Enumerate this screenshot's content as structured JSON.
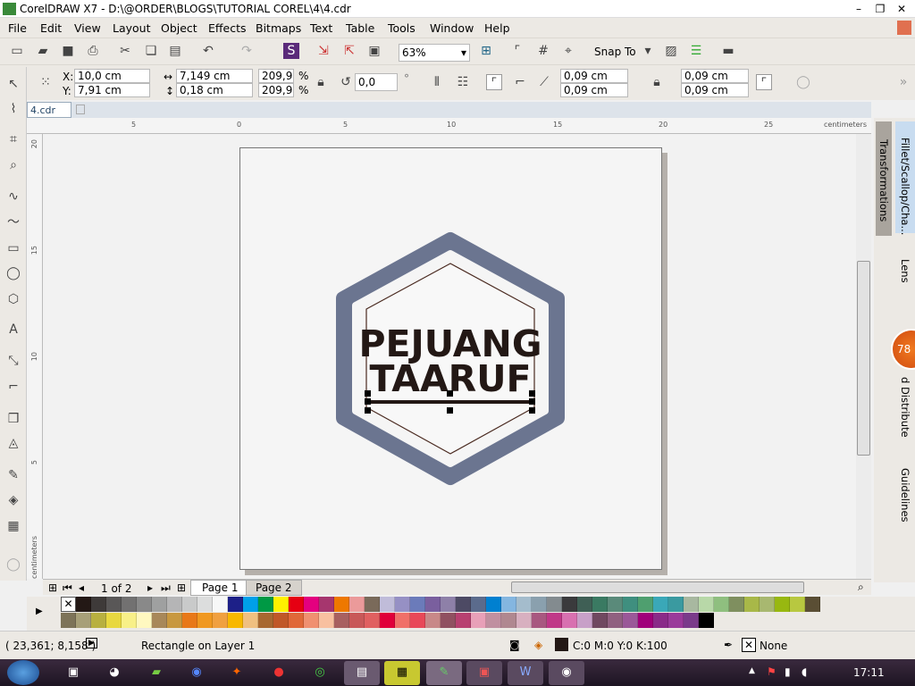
{
  "window": {
    "title": "CorelDRAW X7 - D:\\@ORDER\\BLOGS\\TUTORIAL COREL\\4\\4.cdr"
  },
  "menu": [
    "File",
    "Edit",
    "View",
    "Layout",
    "Object",
    "Effects",
    "Bitmaps",
    "Text",
    "Table",
    "Tools",
    "Window",
    "Help"
  ],
  "toolbar": {
    "zoom": "63%",
    "snap_to": "Snap To"
  },
  "propbar": {
    "x": "10,0 cm",
    "y": "7,91 cm",
    "x_label": "X:",
    "y_label": "Y:",
    "width": "7,149 cm",
    "height": "0,18 cm",
    "scale_x": "209,9",
    "scale_y": "209,9",
    "pct": "%",
    "rotation": "0,0",
    "degree": "°",
    "corner_tl": "0,09 cm",
    "corner_bl": "0,09 cm",
    "corner_tr": "0,09 cm",
    "corner_br": "0,09 cm"
  },
  "document": {
    "tab": "4.cdr",
    "ruler_unit": "centimeters",
    "ruler_left_unit": "centimeters",
    "top_ticks": [
      "5",
      "0",
      "5",
      "10",
      "15",
      "20",
      "25"
    ],
    "left_ticks": [
      "20",
      "15",
      "10",
      "5"
    ]
  },
  "artwork": {
    "line1": "PEJUANG",
    "line2": "TAARUF",
    "hex_color": "#6b7590",
    "text_color": "#231815"
  },
  "dockers": [
    "Transformations",
    "Fillet/Scallop/Cha...",
    "Lens",
    "d Distribute",
    "Guidelines"
  ],
  "badge": "78",
  "pagenav": {
    "counter": "1 of 2",
    "pages": [
      "Page 1",
      "Page 2"
    ]
  },
  "palette": {
    "row1": [
      "#231815",
      "#3e3a39",
      "#595757",
      "#727171",
      "#898989",
      "#9fa0a0",
      "#b5b5b6",
      "#c9caca",
      "#dcdddd",
      "#f7f8f8",
      "#1d2088",
      "#00a0e9",
      "#009944",
      "#fff100",
      "#e60012",
      "#e4007f",
      "#a6366e",
      "#ee7800",
      "#eb9a9a",
      "#7a6a5a",
      "#c0bcd9",
      "#9690c4",
      "#6b7bba",
      "#7a5f9e",
      "#8e80a8",
      "#4d4a64",
      "#5b6b8c",
      "#0080d0",
      "#84b6e0",
      "#a4bccc",
      "#8aa0ae",
      "#838b8f",
      "#3a3a3c",
      "#3f5f55",
      "#3a7a62",
      "#5a8a7a",
      "#3f8f7f",
      "#4f9f6f",
      "#3aa8b8",
      "#3a9aa0",
      "#a8b8a0",
      "#b8d8a8",
      "#8fbf7f",
      "#7f8f5f",
      "#a8b848",
      "#a8b870",
      "#98b810",
      "#b8c840",
      "#5a4e34"
    ],
    "row2": [
      "#7d7358",
      "#a79f78",
      "#b8b040",
      "#e8d840",
      "#f8f088",
      "#fff8c0",
      "#a8885a",
      "#c89840",
      "#e87818",
      "#f09820",
      "#f0a040",
      "#f8b800",
      "#f0c080",
      "#a86830",
      "#c05828",
      "#e06838",
      "#f09070",
      "#f8c0a0",
      "#a86060",
      "#c85858",
      "#e06060",
      "#e0003a",
      "#f07068",
      "#e84858",
      "#c88888",
      "#905060",
      "#b84070",
      "#e8a0b8",
      "#c090a0",
      "#b08890",
      "#d8b0c0",
      "#a85880",
      "#c03888",
      "#d870b0",
      "#c8a0c8",
      "#704860",
      "#906080",
      "#9a5898",
      "#a0007a",
      "#8a2a88",
      "#9a3a9a",
      "#7a3a8a",
      "#000000"
    ]
  },
  "status": {
    "coords": "( 23,361; 8,158 )",
    "object": "Rectangle on Layer 1",
    "fill": "C:0 M:0 Y:0 K:100",
    "outline": "None"
  },
  "taskbar": {
    "clock": "17:11"
  }
}
